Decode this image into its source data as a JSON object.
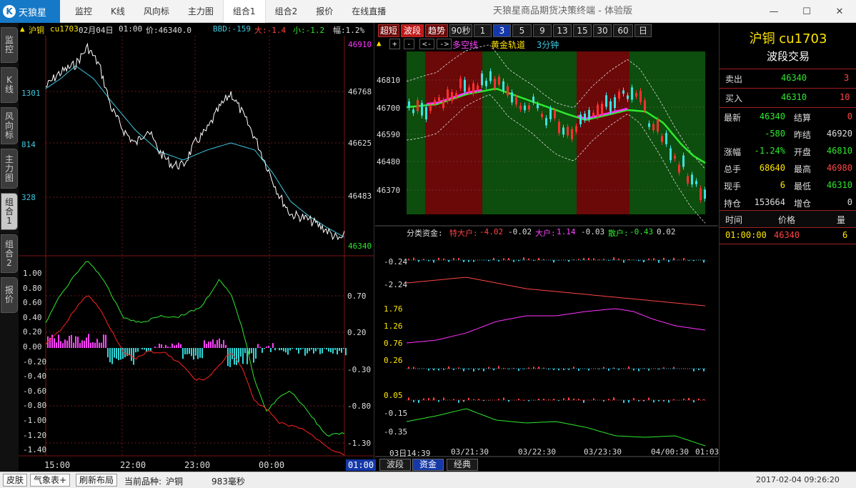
{
  "app": {
    "brand": "天狼星",
    "title": "天狼星商品期货决策终端 - 体验版",
    "menu": [
      "监控",
      "K线",
      "风向标",
      "主力图",
      "组合1",
      "组合2",
      "报价",
      "在线直播"
    ],
    "active_menu": "组合1",
    "win_min": "—",
    "win_max": "☐",
    "win_close": "✕"
  },
  "left_tabs": [
    "监控",
    "K线",
    "风向标",
    "主力图",
    "组合1",
    "组合2",
    "报价"
  ],
  "left_chart": {
    "header": {
      "warn": "▲",
      "name": "沪铜",
      "code": "cu1703",
      "date": "02月04日",
      "time": "01:00",
      "price": "价:46340.0",
      "bbd": "BBD:-159",
      "big": "大:-1.4",
      "small": "小:-1.2",
      "range": "幅:1.2%"
    },
    "price_axis": [
      "46910",
      "46768",
      "46625",
      "46483",
      "46340"
    ],
    "vol_axis": [
      "1301",
      "814",
      "328"
    ],
    "ind_left_axis": [
      "1.00",
      "0.80",
      "0.60",
      "0.40",
      "0.20",
      "0.00",
      "-0.20",
      "-0.40",
      "-0.60",
      "-0.80",
      "-1.00",
      "-1.20",
      "-1.40"
    ],
    "ind_right_axis": [
      "0.70",
      "0.20",
      "-0.30",
      "-0.80",
      "-1.30"
    ],
    "time_axis": [
      "15:00",
      "22:00",
      "23:00",
      "00:00"
    ],
    "time_current": "01:00",
    "colors": {
      "price": "#ffffff",
      "avg": "#3ec8e0",
      "green": "#2ee82e",
      "red": "#ff2222",
      "hist_pos": "#ff44ff",
      "hist_neg": "#33d6d6"
    }
  },
  "mid_chart": {
    "toolbar": [
      "超短",
      "波段",
      "趋势",
      "90秒",
      "1",
      "3",
      "5",
      "9",
      "13",
      "15",
      "30",
      "60",
      "日"
    ],
    "toolbar_active": "波段",
    "toolbar_num_active": "3",
    "sub_controls": [
      "▲",
      "+",
      "-",
      "<-",
      "->"
    ],
    "legend": {
      "bull_bear": "多空线",
      "gold": "黄金轨道",
      "period": "3分钟"
    },
    "price_axis": [
      "46810",
      "46700",
      "46590",
      "46480",
      "46370"
    ],
    "funds": {
      "label": "分类资金:",
      "t_big_label": "特大户:",
      "t_big": "-4.02",
      "t_big2": "-0.02",
      "big_label": "大户:",
      "big": "1.14",
      "big2": "-0.03",
      "retail_label": "散户:",
      "retail": "-0.43",
      "retail2": "0.02"
    },
    "funds_axis": [
      "-0.24",
      "-2.24",
      "1.76",
      "1.26",
      "0.76",
      "0.26",
      "0.05",
      "-0.15",
      "-0.35"
    ],
    "time_axis": [
      "03日14:39",
      "03/21:30",
      "03/22:30",
      "03/23:30",
      "04/00:30",
      "01:03"
    ],
    "bottom_tabs": [
      "波段",
      "资金",
      "经典"
    ],
    "bottom_active": "资金",
    "colors": {
      "bull": "#0d4d0d",
      "bear": "#6b0808",
      "candle_up": "#ff3030",
      "candle_down": "#40e0e0",
      "gold": "#2ee82e",
      "magenta": "#ff33ff"
    }
  },
  "right_panel": {
    "title": "沪铜 cu1703",
    "subtitle": "波段交易",
    "sell": {
      "label": "卖出",
      "price": "46340",
      "vol": "3"
    },
    "buy": {
      "label": "买入",
      "price": "46310",
      "vol": "10"
    },
    "quotes": [
      {
        "l1": "最新",
        "v1": "46340",
        "l2": "结算",
        "v2": "0"
      },
      {
        "l1": "",
        "v1": "-580",
        "l2": "昨结",
        "v2": "46920"
      },
      {
        "l1": "涨幅",
        "v1": "-1.24%",
        "l2": "开盘",
        "v2": "46810"
      },
      {
        "l1": "总手",
        "v1": "68640",
        "l2": "最高",
        "v2": "46980"
      },
      {
        "l1": "现手",
        "v1": "6",
        "l2": "最低",
        "v2": "46310"
      },
      {
        "l1": "持仓",
        "v1": "153664",
        "l2": "增仓",
        "v2": "0"
      }
    ],
    "trade_header": {
      "time": "时间",
      "price": "价格",
      "vol": "量"
    },
    "trades": [
      {
        "time": "01:00:00",
        "price": "46340",
        "vol": "6"
      }
    ]
  },
  "status": {
    "skin": "皮肤",
    "weather": "气象表+",
    "refresh": "刷新布局",
    "current_label": "当前品种:",
    "current": "沪铜",
    "latency": "983毫秒",
    "datetime": "2017-02-04  09:26:20"
  }
}
